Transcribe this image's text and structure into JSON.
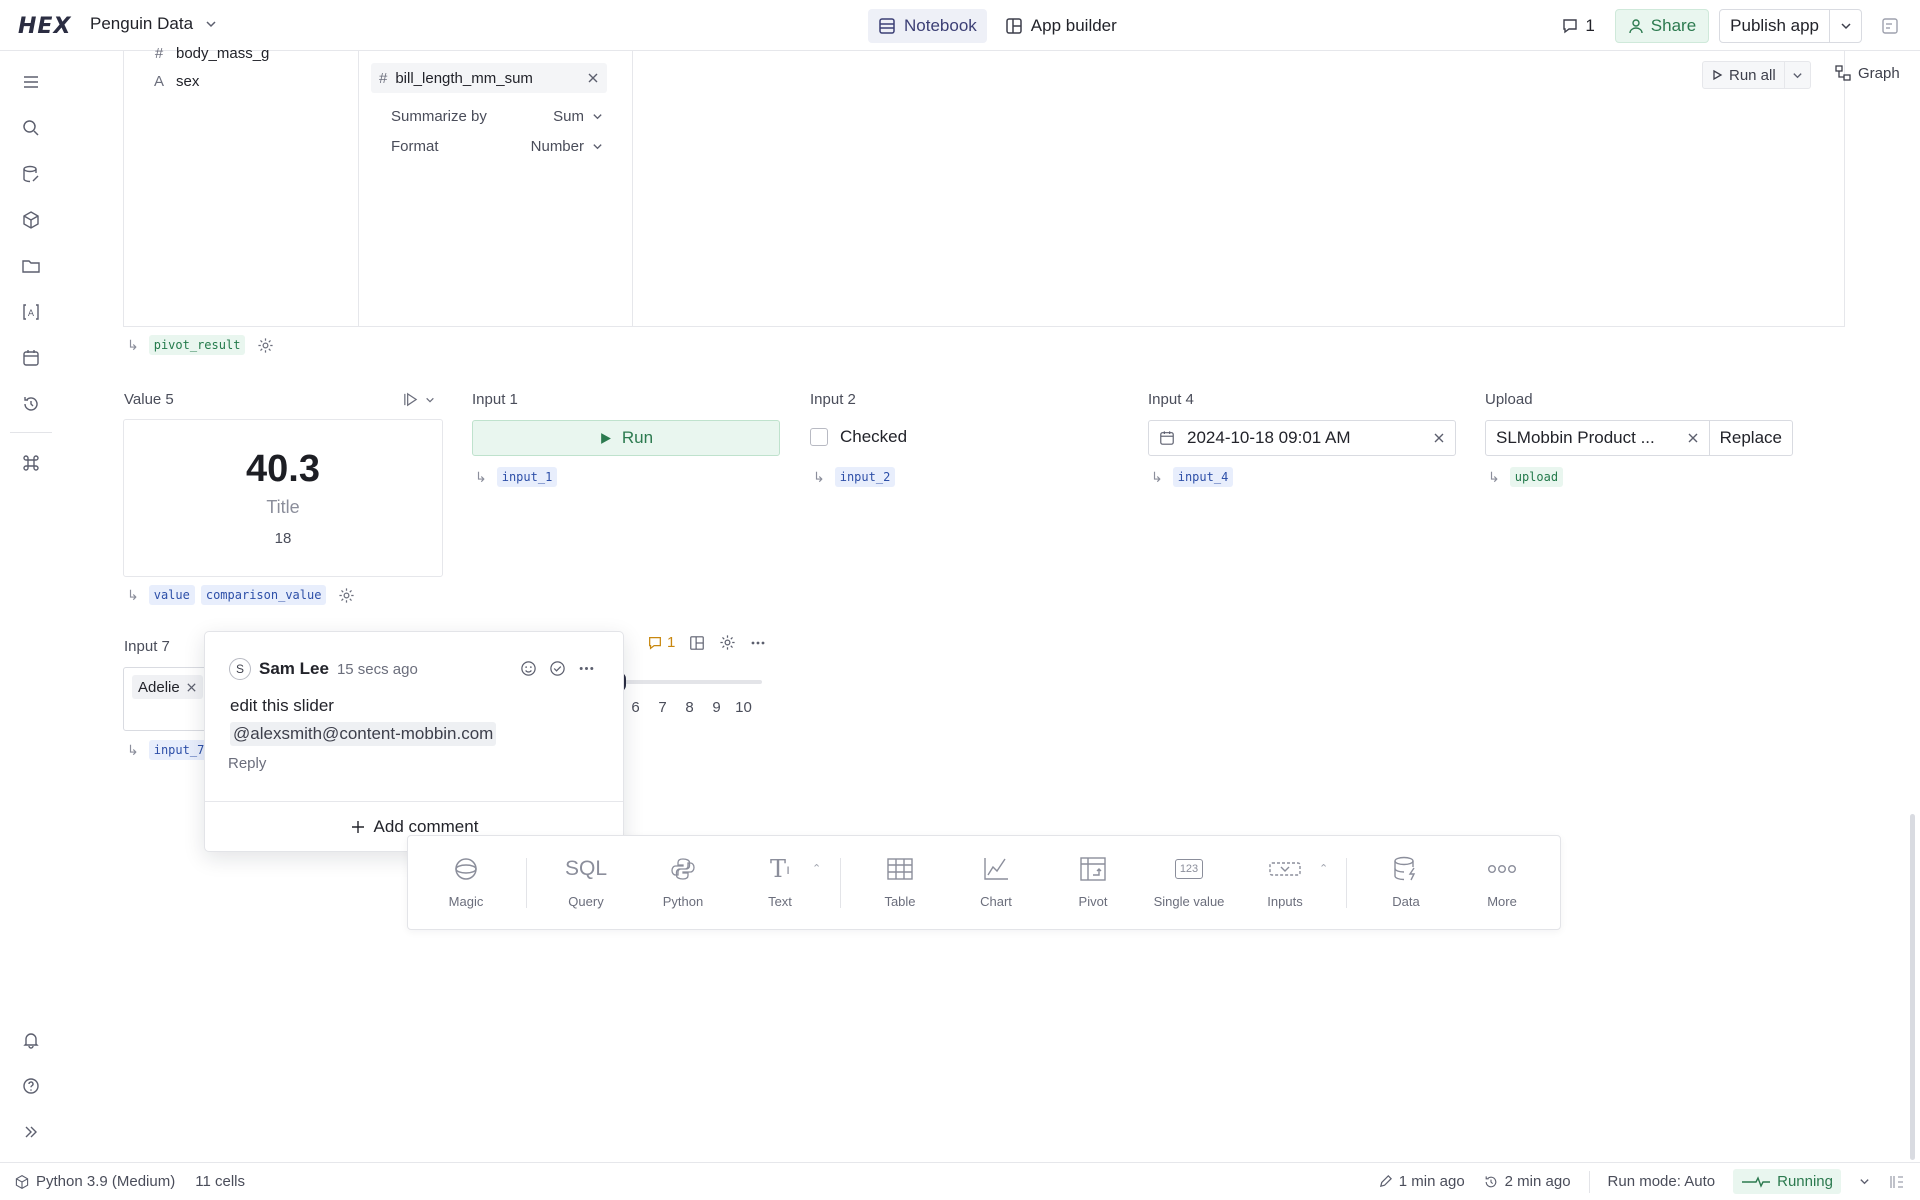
{
  "topbar": {
    "logo": "HEX",
    "project_name": "Penguin Data",
    "tabs": [
      {
        "label": "Notebook",
        "active": true
      },
      {
        "label": "App builder",
        "active": false
      }
    ],
    "comment_count": "1",
    "share_label": "Share",
    "publish_label": "Publish app"
  },
  "rail": {
    "icons": [
      "outline-icon",
      "search-icon",
      "data-browser-icon",
      "components-icon",
      "files-icon",
      "variables-icon",
      "schedule-icon",
      "history-icon",
      "command-icon",
      "bell-icon",
      "help-icon",
      "expand-icon"
    ]
  },
  "pivot": {
    "fields": [
      {
        "type": "#",
        "name": "body_mass_g"
      },
      {
        "type": "A",
        "name": "sex"
      }
    ],
    "value_chip": "bill_length_mm_sum",
    "options": [
      {
        "label": "Summarize by",
        "value": "Sum"
      },
      {
        "label": "Format",
        "value": "Number"
      }
    ],
    "run_all_label": "Run all",
    "graph_label": "Graph",
    "output_var": "pivot_result"
  },
  "cells": {
    "value5": {
      "label": "Value 5",
      "value": "40.3",
      "title": "Title",
      "comparison": "18",
      "vars": [
        "value",
        "comparison_value"
      ]
    },
    "input1": {
      "label": "Input 1",
      "button": "Run",
      "var": "input_1"
    },
    "input2": {
      "label": "Input 2",
      "checkbox_label": "Checked",
      "var": "input_2"
    },
    "input4": {
      "label": "Input 4",
      "date": "2024-10-18 09:01 AM",
      "var": "input_4"
    },
    "upload": {
      "label": "Upload",
      "file": "SLMobbin Product ...",
      "replace_label": "Replace",
      "var": "upload"
    },
    "input7": {
      "label": "Input 7",
      "chip": "Adelie",
      "var": "input_7",
      "ticks": [
        "6",
        "7",
        "8",
        "9",
        "10"
      ],
      "comment_count": "1"
    }
  },
  "comment": {
    "avatar": "S",
    "author": "Sam Lee",
    "time": "15 secs ago",
    "text": "edit this slider",
    "mention": "@alexsmith@content-mobbin.com",
    "reply_label": "Reply",
    "add_comment_label": "Add comment"
  },
  "cellbar": {
    "items": [
      {
        "label": "Magic",
        "icon": "magic-icon"
      },
      {
        "label": "Query",
        "icon": "sql-icon",
        "glyph": "SQL"
      },
      {
        "label": "Python",
        "icon": "python-icon"
      },
      {
        "label": "Text",
        "icon": "text-icon"
      },
      {
        "label": "Table",
        "icon": "table-icon"
      },
      {
        "label": "Chart",
        "icon": "chart-icon"
      },
      {
        "label": "Pivot",
        "icon": "pivot-icon"
      },
      {
        "label": "Single value",
        "icon": "single-value-icon",
        "glyph": "123"
      },
      {
        "label": "Inputs",
        "icon": "inputs-icon"
      },
      {
        "label": "Data",
        "icon": "data-icon"
      },
      {
        "label": "More",
        "icon": "more-icon"
      }
    ]
  },
  "status": {
    "kernel": "Python 3.9 (Medium)",
    "cells": "11 cells",
    "edited": "1 min ago",
    "saved": "2 min ago",
    "run_mode": "Run mode: Auto",
    "state": "Running"
  },
  "colors": {
    "accent_green": "#2c7a4f",
    "accent_blue": "#2d4fa8",
    "comment_orange": "#c8870f"
  }
}
